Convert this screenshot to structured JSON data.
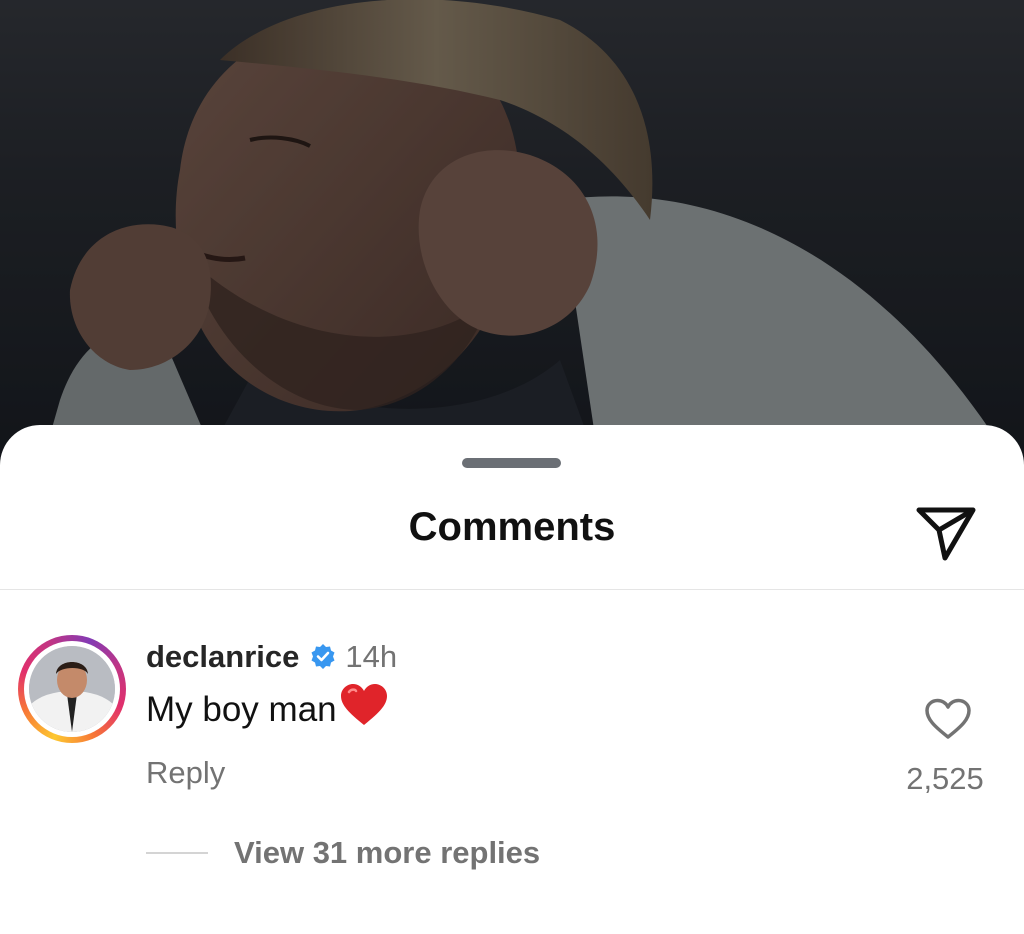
{
  "sheet": {
    "title": "Comments",
    "share_icon": "paper-plane-icon"
  },
  "comment": {
    "username": "declanrice",
    "verified": true,
    "time": "14h",
    "text": "My boy man",
    "emoji": "red-heart",
    "reply_label": "Reply",
    "like_icon": "heart-outline-icon",
    "like_count": "2,525",
    "view_replies": "View 31 more replies"
  },
  "colors": {
    "verified_blue": "#3897f0",
    "secondary_text": "#737373",
    "primary_text": "#111111",
    "emoji_red": "#e0242a"
  }
}
